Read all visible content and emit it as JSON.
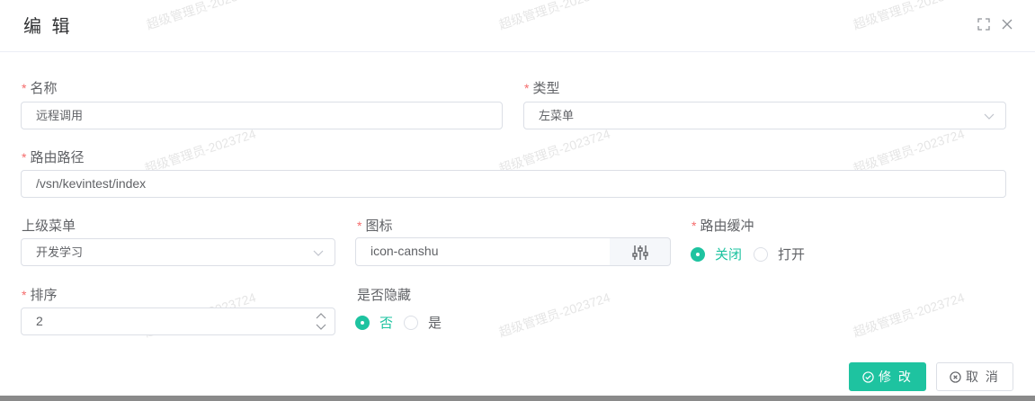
{
  "dialog": {
    "title": "编 辑"
  },
  "form": {
    "name": {
      "label": "名称",
      "value": "远程调用"
    },
    "type": {
      "label": "类型",
      "value": "左菜单"
    },
    "route_path": {
      "label": "路由路径",
      "value": "/vsn/kevintest/index"
    },
    "parent_menu": {
      "label": "上级菜单",
      "value": "开发学习"
    },
    "icon": {
      "label": "图标",
      "value": "icon-canshu"
    },
    "route_cache": {
      "label": "路由缓冲",
      "options": [
        "关闭",
        "打开"
      ],
      "selected": "关闭"
    },
    "sort": {
      "label": "排序",
      "value": "2"
    },
    "hidden": {
      "label": "是否隐藏",
      "options": [
        "否",
        "是"
      ],
      "selected": "否"
    }
  },
  "footer": {
    "submit_label": "修 改",
    "cancel_label": "取 消"
  },
  "watermark": "超级管理员-2023724",
  "colors": {
    "accent": "#1ec3a0",
    "required": "#f56c6c"
  }
}
